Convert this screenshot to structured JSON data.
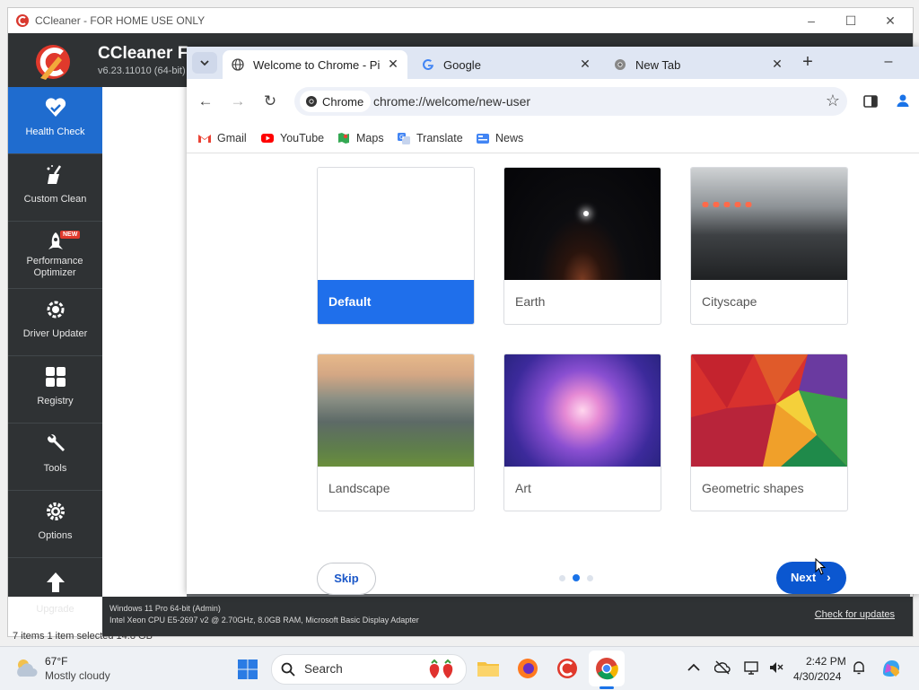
{
  "ccleaner": {
    "window_title": "CCleaner - FOR HOME USE ONLY",
    "brand": "CCleaner Fr",
    "version": "v6.23.11010 (64-bit)",
    "nav": [
      {
        "label": "Health Check"
      },
      {
        "label": "Custom Clean"
      },
      {
        "label": "Performance Optimizer",
        "badge": "NEW"
      },
      {
        "label": "Driver Updater"
      },
      {
        "label": "Registry"
      },
      {
        "label": "Tools"
      },
      {
        "label": "Options"
      },
      {
        "label": "Upgrade"
      }
    ],
    "footer": {
      "os": "Windows 11 Pro 64-bit (Admin)",
      "hw": "Intel Xeon CPU E5-2697 v2 @ 2.70GHz, 8.0GB RAM, Microsoft Basic Display Adapter",
      "update_link": "Check for updates"
    },
    "status_line": "7 items     1 item selected  14.8 GB"
  },
  "chrome": {
    "tabs": [
      {
        "title": "Welcome to Chrome - Pic",
        "active": true
      },
      {
        "title": "Google",
        "active": false
      },
      {
        "title": "New Tab",
        "active": false
      }
    ],
    "site_chip": "Chrome",
    "url": "chrome://welcome/new-user",
    "bookmarks": [
      "Gmail",
      "YouTube",
      "Maps",
      "Translate",
      "News"
    ],
    "themes": [
      {
        "label": "Default",
        "selected": true
      },
      {
        "label": "Earth",
        "selected": false
      },
      {
        "label": "Cityscape",
        "selected": false
      },
      {
        "label": "Landscape",
        "selected": false
      },
      {
        "label": "Art",
        "selected": false
      },
      {
        "label": "Geometric shapes",
        "selected": false
      }
    ],
    "skip_label": "Skip",
    "next_label": "Next",
    "page_step": {
      "current": 2,
      "total": 3
    }
  },
  "taskbar": {
    "weather_temp": "67°F",
    "weather_desc": "Mostly cloudy",
    "search_label": "Search",
    "time": "2:42 PM",
    "date": "4/30/2024"
  },
  "colors": {
    "ccleaner_dark": "#2f3234",
    "ccleaner_accent": "#1f6ccf",
    "chrome_blue": "#0b57d0"
  }
}
